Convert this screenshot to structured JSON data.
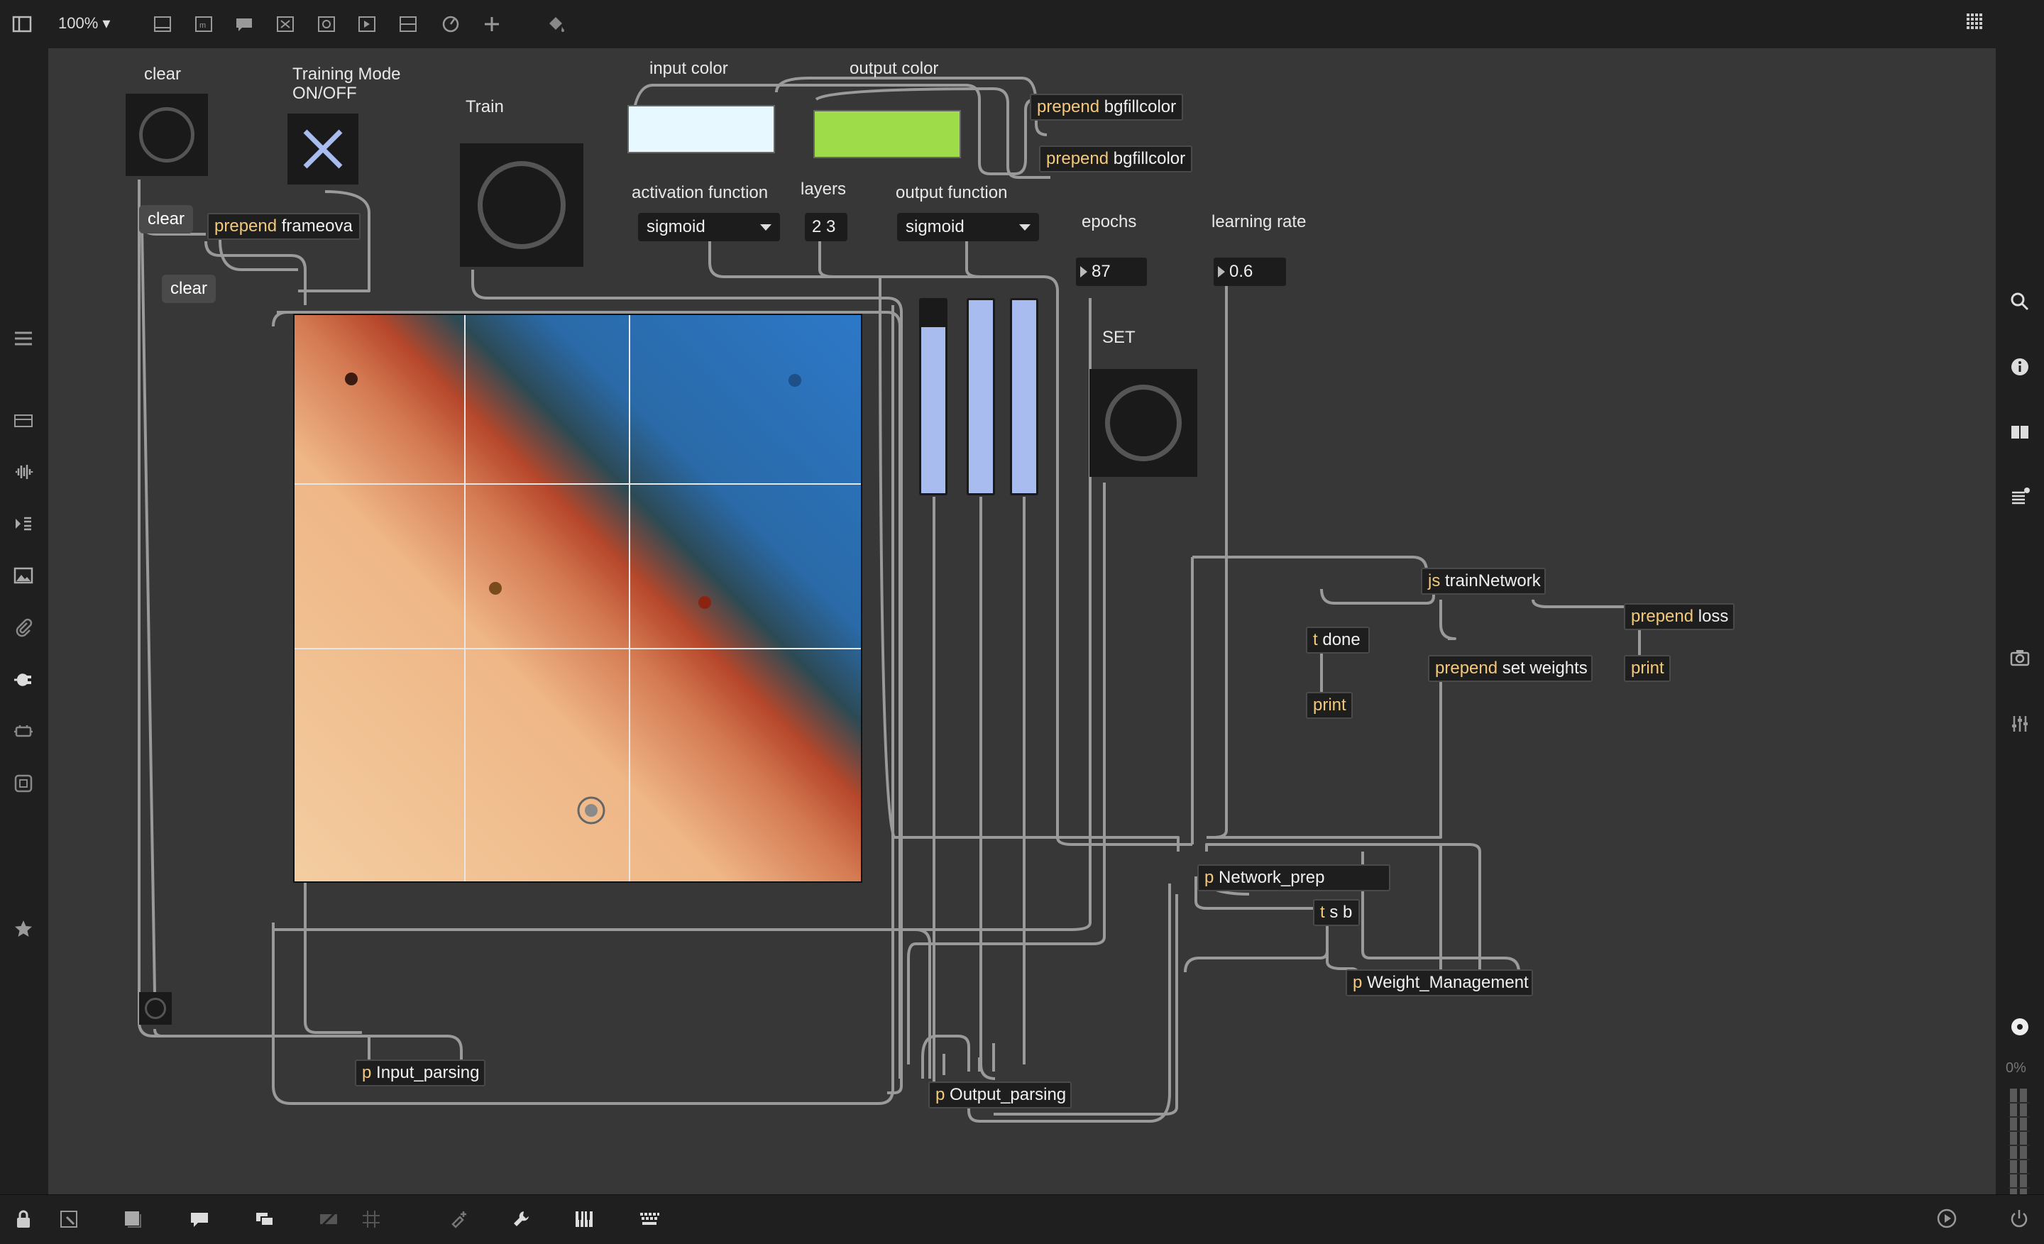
{
  "toolbar": {
    "zoom": "100%",
    "icons": [
      "sidebar-toggle-icon",
      "object-icon",
      "message-icon",
      "comment-icon",
      "toggle-icon",
      "bang-icon",
      "button-icon",
      "slider-icon",
      "dial-icon",
      "add-icon",
      "paint-bucket-icon",
      "grid-apps-icon"
    ]
  },
  "patch": {
    "bang_clear_label": "clear",
    "toggle_label_line1": "Training Mode",
    "toggle_label_line2": "ON/OFF",
    "train_label": "Train",
    "input_color_label": "input color",
    "output_color_label": "output color",
    "input_color": "#e8f8ff",
    "output_color": "#9fdc4a",
    "activation_label": "activation function",
    "activation_value": "sigmoid",
    "layers_label": "layers",
    "layers_value": "2 3",
    "output_function_label": "output function",
    "output_function_value": "sigmoid",
    "epochs_label": "epochs",
    "epochs_value": "87",
    "learning_rate_label": "learning rate",
    "learning_rate_value": "0.6",
    "set_label": "SET",
    "msg_clear_1": "clear",
    "msg_clear_2": "clear",
    "prepend_frameova_kw": "prepend",
    "prepend_frameova_arg": "frameova",
    "prepend_bg1_kw": "prepend",
    "prepend_bg1_arg": "bgfillcolor",
    "prepend_bg2_kw": "prepend",
    "prepend_bg2_arg": "bgfillcolor",
    "js_kw": "js",
    "js_arg": "trainNetwork",
    "tdone_kw": "t",
    "tdone_arg": "done",
    "print1": "print",
    "prepend_weights_kw": "prepend",
    "prepend_weights_arg": "set weights",
    "prepend_loss_kw": "prepend",
    "prepend_loss_arg": "loss",
    "print2": "print",
    "network_prep_kw": "p",
    "network_prep_arg": "Network_prep",
    "tsb_kw": "t",
    "tsb_arg": "s b",
    "weight_mgmt_kw": "p",
    "weight_mgmt_arg": "Weight_Management",
    "input_parsing_kw": "p",
    "input_parsing_arg": "Input_parsing",
    "output_parsing_kw": "p",
    "output_parsing_arg": "Output_parsing",
    "sliders": [
      0.86,
      1.0,
      1.0
    ]
  },
  "right_sidebar": {
    "icons": [
      "search-icon",
      "info-icon",
      "columns-icon",
      "list-icon",
      "camera-icon",
      "mixer-icon",
      "record-icon"
    ],
    "cpu": "0%"
  },
  "left_sidebar": {
    "icons": [
      "menu-icon",
      "inspector-icon",
      "audio-icon",
      "sequence-icon",
      "image-icon",
      "clip-icon",
      "plug-icon",
      "package-icon",
      "frame-icon",
      "star-icon"
    ]
  },
  "bottom_bar": {
    "icons": [
      "lock-icon",
      "presentation-icon",
      "background-icon",
      "comment-bubble-icon",
      "layers-icon",
      "hidden-icon",
      "grid-icon",
      "snap-icon",
      "wrench-icon",
      "piano-icon",
      "keyboard-icon",
      "transport-icon",
      "power-icon"
    ]
  }
}
